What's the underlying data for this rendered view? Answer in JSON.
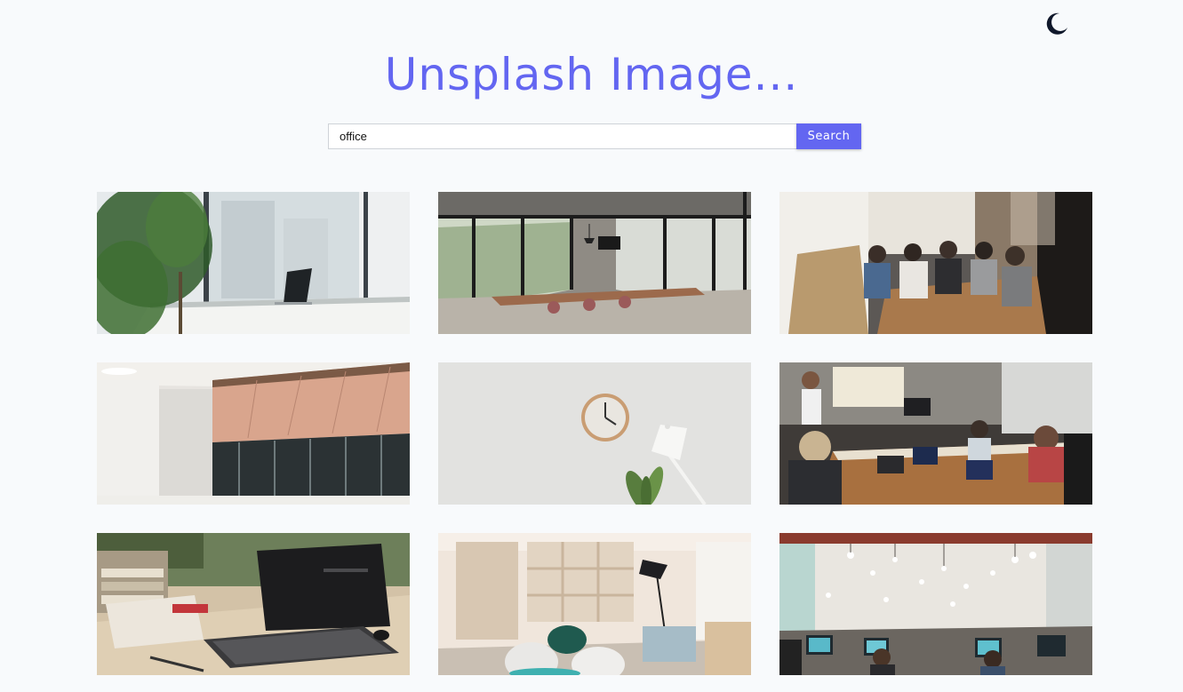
{
  "header": {
    "title": "Unsplash Image...",
    "theme_toggle_icon": "moon-icon"
  },
  "search": {
    "value": "office",
    "placeholder": "",
    "button_label": "Search"
  },
  "colors": {
    "accent": "#6366f1",
    "background": "#f8fafc",
    "moon": "#0f172a"
  },
  "images": [
    {
      "subject": "office-desk-with-laptop-and-plant"
    },
    {
      "subject": "empty-conference-room-with-windows"
    },
    {
      "subject": "team-meeting-around-table"
    },
    {
      "subject": "office-ceiling-and-glass-partitions"
    },
    {
      "subject": "wall-clock-and-lamp"
    },
    {
      "subject": "presentation-meeting-with-laptops"
    },
    {
      "subject": "laptop-with-books-on-desk"
    },
    {
      "subject": "lounge-with-chairs-and-lamp"
    },
    {
      "subject": "open-office-with-hanging-lights"
    }
  ]
}
